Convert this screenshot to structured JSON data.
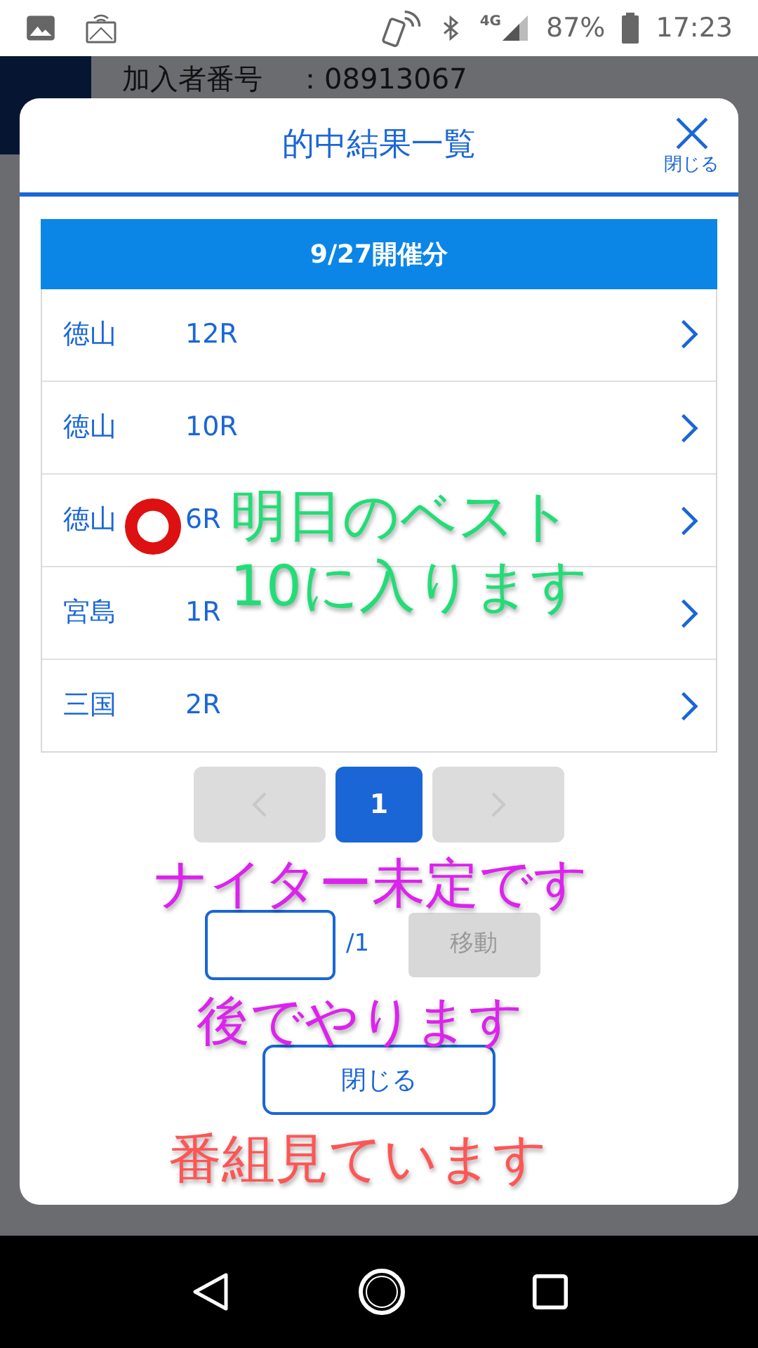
{
  "status_bar": {
    "battery": "87%",
    "time": "17:23",
    "network": "4G"
  },
  "background": {
    "member_label": "加入者番号",
    "member_number": "：08913067"
  },
  "dialog": {
    "title": "的中結果一覧",
    "close_label": "閉じる",
    "section": "9/27開催分",
    "rows": [
      {
        "venue": "徳山",
        "race": "12R"
      },
      {
        "venue": "徳山",
        "race": "10R"
      },
      {
        "venue": "徳山",
        "race": "6R"
      },
      {
        "venue": "宮島",
        "race": "1R"
      },
      {
        "venue": "三国",
        "race": "2R"
      }
    ],
    "pagination": {
      "pages": [
        {
          "label": "1",
          "selected": true
        }
      ],
      "prev_disabled": true,
      "next_disabled": true
    },
    "page_jump": {
      "total": "/1",
      "button": "移動"
    },
    "close_button": "閉じる"
  },
  "annotations": [
    {
      "kind": "text",
      "lines": [
        "明日のベスト",
        "10に入ります"
      ],
      "color": "#22dd77"
    },
    {
      "kind": "text",
      "lines": [
        "ナイター未定です",
        "後でやります"
      ],
      "color": "#dd22ee"
    },
    {
      "kind": "text",
      "lines": [
        "番組見ています"
      ],
      "color": "#ff5555"
    },
    {
      "kind": "circle",
      "color": "#dd1111"
    }
  ]
}
